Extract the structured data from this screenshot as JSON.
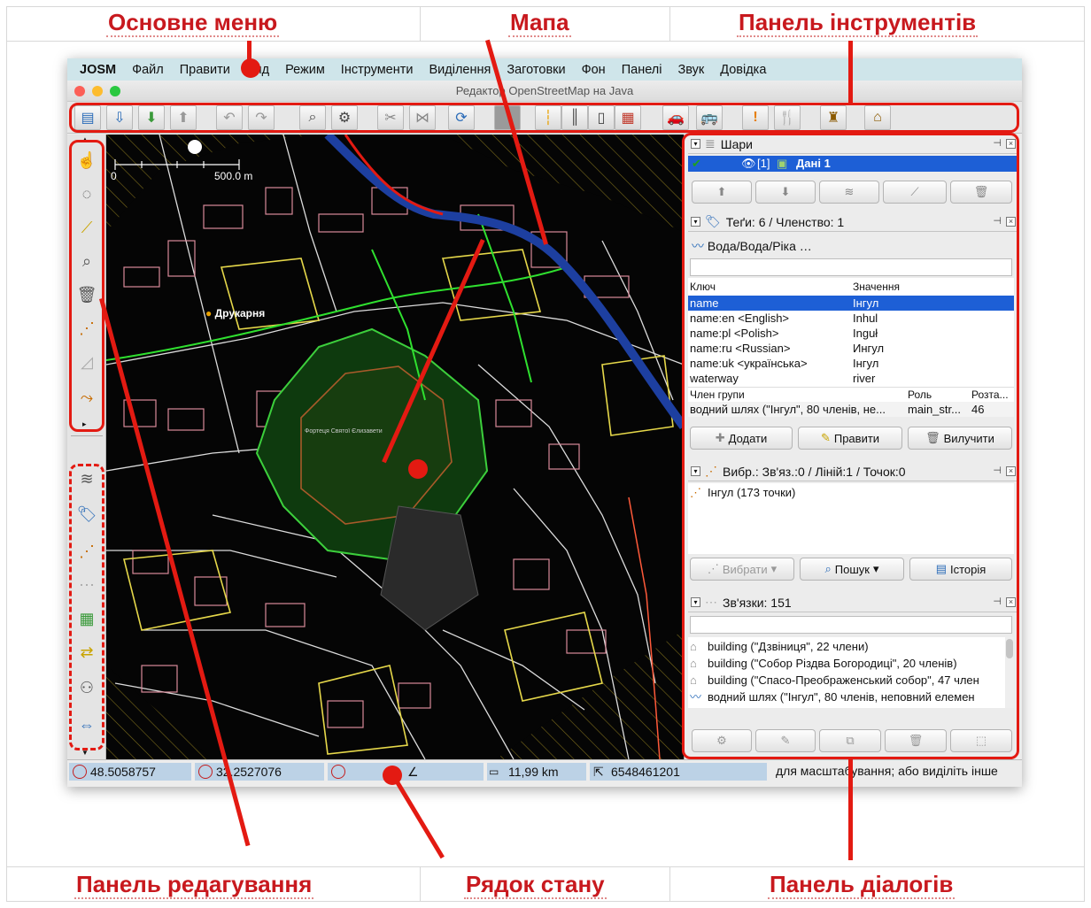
{
  "captions": {
    "main_menu": "Основне меню",
    "map": "Мапа",
    "toolbar": "Панель інструментів",
    "edit_panel": "Панель редагування",
    "status_bar": "Рядок стану",
    "dialogs_panel": "Панель діалогів"
  },
  "menu": {
    "app": "JOSM",
    "items": [
      "Файл",
      "Правити",
      "Вид",
      "Режим",
      "Інструменти",
      "Виділення",
      "Заготовки",
      "Фон",
      "Панелі",
      "Звук",
      "Довідка"
    ]
  },
  "window": {
    "title": "Редактор OpenStreetMap на Java"
  },
  "map": {
    "scale_start": "0",
    "scale_end": "500.0 m",
    "label_print": "Друкарня",
    "label_fortress": "Фортеця Святої Єлизавети"
  },
  "layers": {
    "title": "Шари",
    "layer_index": "[1]",
    "layer_name": "Дані 1"
  },
  "tags": {
    "title": "Теґи: 6 / Членство: 1",
    "preset": "Вода/Вода/Ріка …",
    "col_key": "Ключ",
    "col_value": "Значення",
    "rows": [
      {
        "key": "name",
        "value": "Інгул"
      },
      {
        "key": "name:en <English>",
        "value": "Inhul"
      },
      {
        "key": "name:pl <Polish>",
        "value": "Inguł"
      },
      {
        "key": "name:ru <Russian>",
        "value": "Ингул"
      },
      {
        "key": "name:uk <українська>",
        "value": "Інгул"
      },
      {
        "key": "waterway",
        "value": "river"
      }
    ],
    "member_col": "Член групи",
    "role_col": "Роль",
    "pos_col": "Розта...",
    "member_value": "водний шлях (\"Інгул\", 80 членів, не...",
    "role_value": "main_str...",
    "pos_value": "46",
    "add": "Додати",
    "edit": "Правити",
    "delete": "Вилучити"
  },
  "selection": {
    "title": "Вибр.: Зв'яз.:0 / Ліній:1 / Точок:0",
    "item": "Інгул (173 точки)",
    "select": "Вибрати",
    "search": "Пошук",
    "history": "Історія"
  },
  "relations": {
    "title": "Зв'язки: 151",
    "items": [
      "building (\"Дзвіниця\", 22 члени)",
      "building (\"Собор Різдва Богородиці\", 20 членів)",
      "building (\"Спасо-Преображенський собор\", 47 член",
      "водний шлях (\"Інгул\", 80 членів, неповний елемен"
    ]
  },
  "status": {
    "lat": "48.5058757",
    "lon": "32.2527076",
    "distance": "11,99 km",
    "id": "6548461201",
    "help": "для масштабування; або виділіть інше"
  },
  "colors": {
    "accent": "#e31a12",
    "selection": "#1d5fd6",
    "caption": "#c8191e"
  }
}
